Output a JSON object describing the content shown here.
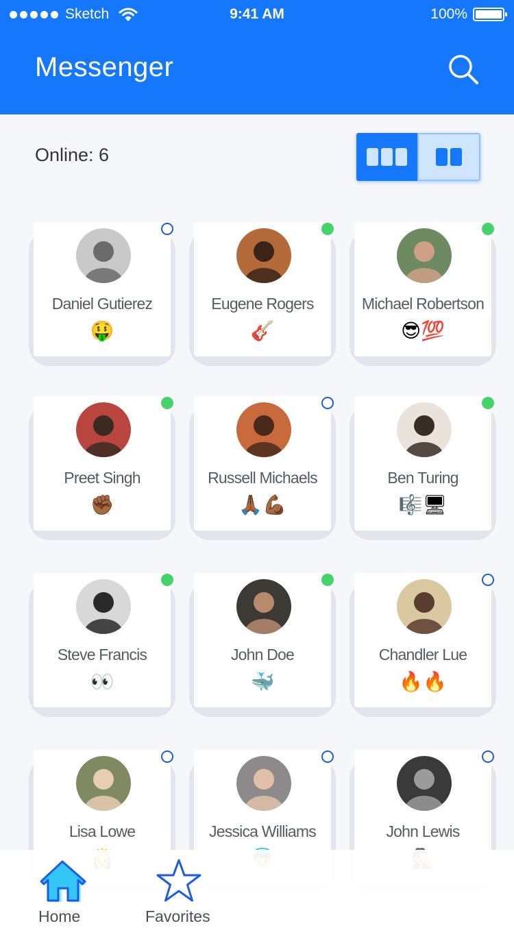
{
  "status_bar": {
    "carrier": "Sketch",
    "time": "9:41 AM",
    "battery": "100%"
  },
  "header": {
    "title": "Messenger"
  },
  "summary": {
    "online_label": "Online: 6"
  },
  "colors": {
    "brand": "#1577fb",
    "online": "#47d36c",
    "offline_ring": "#1b5be6"
  },
  "contacts": [
    {
      "name": "Daniel Gutierez",
      "emoji": "🤑",
      "online": false,
      "avatar_bg": "#c9c9c9",
      "avatar_fg": "#6b6b6b"
    },
    {
      "name": "Eugene Rogers",
      "emoji": "🎸",
      "online": true,
      "avatar_bg": "#b56a3a",
      "avatar_fg": "#3a2418"
    },
    {
      "name": "Michael Robertson",
      "emoji": "😎💯",
      "online": true,
      "avatar_bg": "#6d8a63",
      "avatar_fg": "#cf9f86"
    },
    {
      "name": "Preet Singh",
      "emoji": "✊🏾",
      "online": true,
      "avatar_bg": "#b8463f",
      "avatar_fg": "#3b2a22"
    },
    {
      "name": "Russell Michaels",
      "emoji": "🙏🏾💪🏾",
      "online": false,
      "avatar_bg": "#c86a3c",
      "avatar_fg": "#4a2a1b"
    },
    {
      "name": "Ben Turing",
      "emoji": "🎼🖥",
      "online": true,
      "avatar_bg": "#e9e3dc",
      "avatar_fg": "#3a2d28"
    },
    {
      "name": "Steve Francis",
      "emoji": "👀",
      "online": true,
      "avatar_bg": "#d8d8d8",
      "avatar_fg": "#2a2a2a"
    },
    {
      "name": "John Doe",
      "emoji": "🐳",
      "online": true,
      "avatar_bg": "#3d3a36",
      "avatar_fg": "#b78a6e"
    },
    {
      "name": "Chandler Lue",
      "emoji": "🔥🔥",
      "online": false,
      "avatar_bg": "#d9c8a0",
      "avatar_fg": "#5a3d2e"
    },
    {
      "name": "Lisa Lowe",
      "emoji": "👸",
      "online": false,
      "avatar_bg": "#7f8a62",
      "avatar_fg": "#e8cdb5"
    },
    {
      "name": "Jessica Williams",
      "emoji": "👼",
      "online": false,
      "avatar_bg": "#8c8a8a",
      "avatar_fg": "#e0c1a8"
    },
    {
      "name": "John Lewis",
      "emoji": "🕵",
      "online": false,
      "avatar_bg": "#3a3a3a",
      "avatar_fg": "#9b9b9b"
    }
  ],
  "tabs": [
    {
      "label": "Home",
      "icon": "home-icon",
      "active": true
    },
    {
      "label": "Favorites",
      "icon": "star-icon",
      "active": false
    }
  ]
}
